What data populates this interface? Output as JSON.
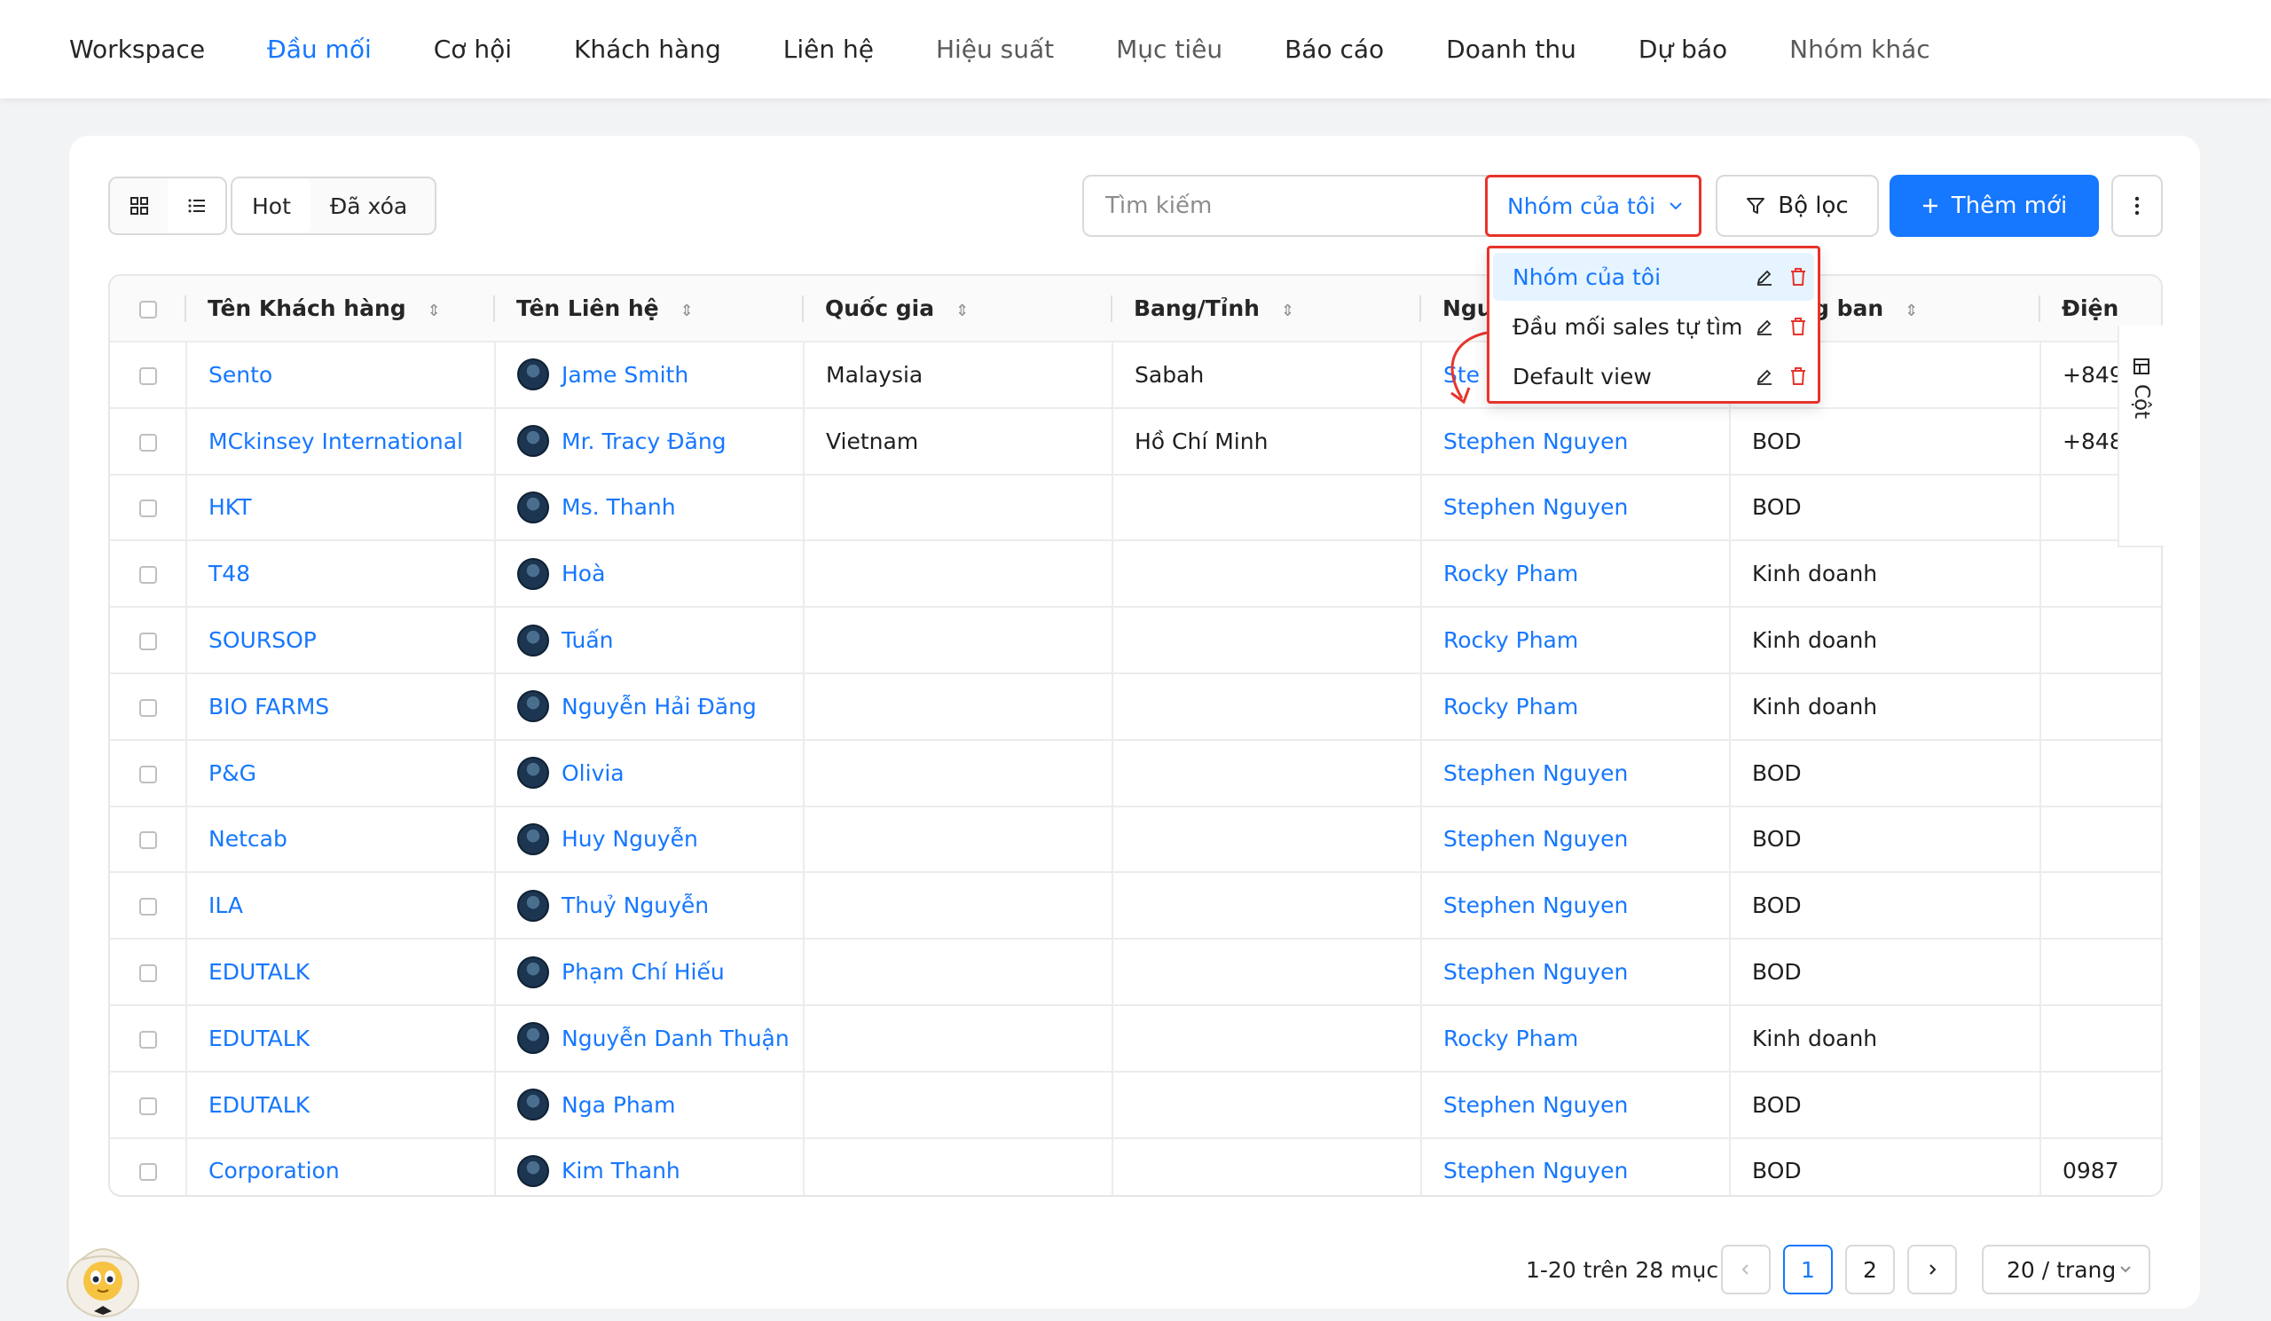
{
  "nav": {
    "items": [
      {
        "label": "Workspace",
        "state": "normal"
      },
      {
        "label": "Đầu mối",
        "state": "active"
      },
      {
        "label": "Cơ hội",
        "state": "normal"
      },
      {
        "label": "Khách hàng",
        "state": "normal"
      },
      {
        "label": "Liên hệ",
        "state": "normal"
      },
      {
        "label": "Hiệu suất",
        "state": "muted"
      },
      {
        "label": "Mục tiêu",
        "state": "muted"
      },
      {
        "label": "Báo cáo",
        "state": "normal"
      },
      {
        "label": "Doanh thu",
        "state": "normal"
      },
      {
        "label": "Dự báo",
        "state": "normal"
      },
      {
        "label": "Nhóm khác",
        "state": "muted"
      }
    ]
  },
  "toolbar": {
    "segments": [
      "Hot",
      "Đã xóa"
    ],
    "search_placeholder": "Tìm kiếm",
    "view_select_value": "Nhóm của tôi",
    "filter_label": "Bộ lọc",
    "add_label": "Thêm mới"
  },
  "dropdown": {
    "items": [
      "Nhóm của tôi",
      "Đầu mối sales tự tìm",
      "Default view"
    ]
  },
  "table": {
    "columns": [
      "Tên Khách hàng",
      "Tên Liên hệ",
      "Quốc gia",
      "Bang/Tỉnh",
      "Ngư",
      "g ban",
      "Điện"
    ],
    "rows": [
      {
        "customer": "Sento",
        "contact": "Jame Smith",
        "country": "Malaysia",
        "state": "Sabah",
        "owner": "Ste",
        "dept": "",
        "phone": "+849"
      },
      {
        "customer": "MCkinsey International",
        "contact": "Mr. Tracy Đăng",
        "country": "Vietnam",
        "state": "Hồ Chí Minh",
        "owner": "Stephen Nguyen",
        "dept": "BOD",
        "phone": "+848"
      },
      {
        "customer": "HKT",
        "contact": "Ms. Thanh",
        "country": "",
        "state": "",
        "owner": "Stephen Nguyen",
        "dept": "BOD",
        "phone": ""
      },
      {
        "customer": "T48",
        "contact": "Hoà",
        "country": "",
        "state": "",
        "owner": "Rocky Pham",
        "dept": "Kinh doanh",
        "phone": ""
      },
      {
        "customer": "SOURSOP",
        "contact": "Tuấn",
        "country": "",
        "state": "",
        "owner": "Rocky Pham",
        "dept": "Kinh doanh",
        "phone": ""
      },
      {
        "customer": "BIO FARMS",
        "contact": "Nguyễn Hải Đăng",
        "country": "",
        "state": "",
        "owner": "Rocky Pham",
        "dept": "Kinh doanh",
        "phone": ""
      },
      {
        "customer": "P&G",
        "contact": "Olivia",
        "country": "",
        "state": "",
        "owner": "Stephen Nguyen",
        "dept": "BOD",
        "phone": ""
      },
      {
        "customer": "Netcab",
        "contact": "Huy Nguyễn",
        "country": "",
        "state": "",
        "owner": "Stephen Nguyen",
        "dept": "BOD",
        "phone": ""
      },
      {
        "customer": "ILA",
        "contact": "Thuỷ Nguyễn",
        "country": "",
        "state": "",
        "owner": "Stephen Nguyen",
        "dept": "BOD",
        "phone": ""
      },
      {
        "customer": "EDUTALK",
        "contact": "Phạm Chí Hiếu",
        "country": "",
        "state": "",
        "owner": "Stephen Nguyen",
        "dept": "BOD",
        "phone": ""
      },
      {
        "customer": "EDUTALK",
        "contact": "Nguyễn Danh Thuận",
        "country": "",
        "state": "",
        "owner": "Rocky Pham",
        "dept": "Kinh doanh",
        "phone": ""
      },
      {
        "customer": "EDUTALK",
        "contact": "Nga Pham",
        "country": "",
        "state": "",
        "owner": "Stephen Nguyen",
        "dept": "BOD",
        "phone": ""
      },
      {
        "customer": "Corporation",
        "contact": "Kim Thanh",
        "country": "",
        "state": "",
        "owner": "Stephen Nguyen",
        "dept": "BOD",
        "phone": "0987"
      }
    ]
  },
  "column_tab_label": "Cột",
  "pagination": {
    "info": "1-20 trên 28 mục",
    "pages": [
      "1",
      "2"
    ],
    "current": "1",
    "page_size": "20 / trang"
  },
  "colors": {
    "accent": "#1677ff",
    "highlight": "#e8332b"
  }
}
